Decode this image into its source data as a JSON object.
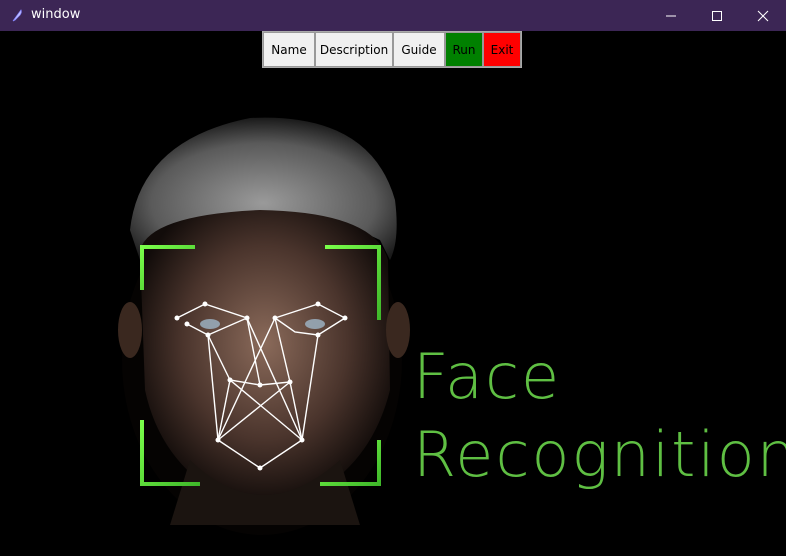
{
  "window": {
    "title": "window",
    "titlebar_color": "#3c2655"
  },
  "toolbar": {
    "name_label": "Name",
    "description_label": "Description",
    "guide_label": "Guide",
    "run_label": "Run",
    "exit_label": "Exit",
    "run_color": "#008000",
    "exit_color": "#ff0000"
  },
  "banner": {
    "line1": "Face",
    "line2": "Recognition",
    "text_color": "#5fbf43"
  },
  "icons": [
    "feather-icon",
    "minimize-icon",
    "maximize-icon",
    "close-icon"
  ]
}
